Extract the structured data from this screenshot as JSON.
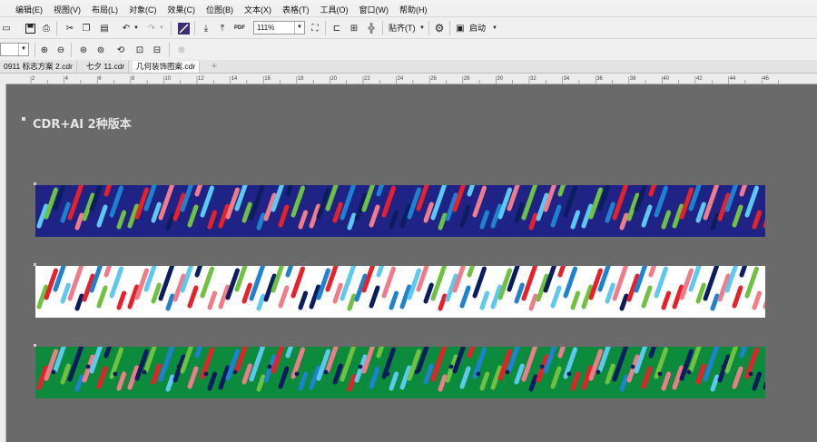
{
  "menu": [
    "编辑(E)",
    "视图(V)",
    "布局(L)",
    "对象(C)",
    "效果(C)",
    "位图(B)",
    "文本(X)",
    "表格(T)",
    "工具(O)",
    "窗口(W)",
    "帮助(H)"
  ],
  "toolbar": {
    "zoom_value": "111%",
    "snap_label": "贴齐(T)",
    "launch_label": "启动",
    "pdf_label": "PDF"
  },
  "tabs": [
    "0911 标志方案 2.cdr",
    "七夕 11.cdr",
    "几何装饰图案.cdr"
  ],
  "ruler": {
    "ticks": [
      "2",
      "4",
      "6",
      "8",
      "10",
      "12",
      "14",
      "16",
      "18",
      "20",
      "22",
      "24",
      "26",
      "28",
      "30",
      "32",
      "34",
      "36",
      "38",
      "40",
      "42",
      "44",
      "46"
    ]
  },
  "canvas": {
    "heading": "CDR+AI 2种版本",
    "bands": [
      {
        "name": "navy",
        "background": "#1f2386"
      },
      {
        "name": "white",
        "background": "#ffffff"
      },
      {
        "name": "green",
        "background": "#0c8b3c"
      }
    ],
    "stripe_colors": [
      "#0b1d5e",
      "#1d82d0",
      "#5dc8f0",
      "#6fc23f",
      "#e8202a",
      "#f07c8a"
    ]
  }
}
